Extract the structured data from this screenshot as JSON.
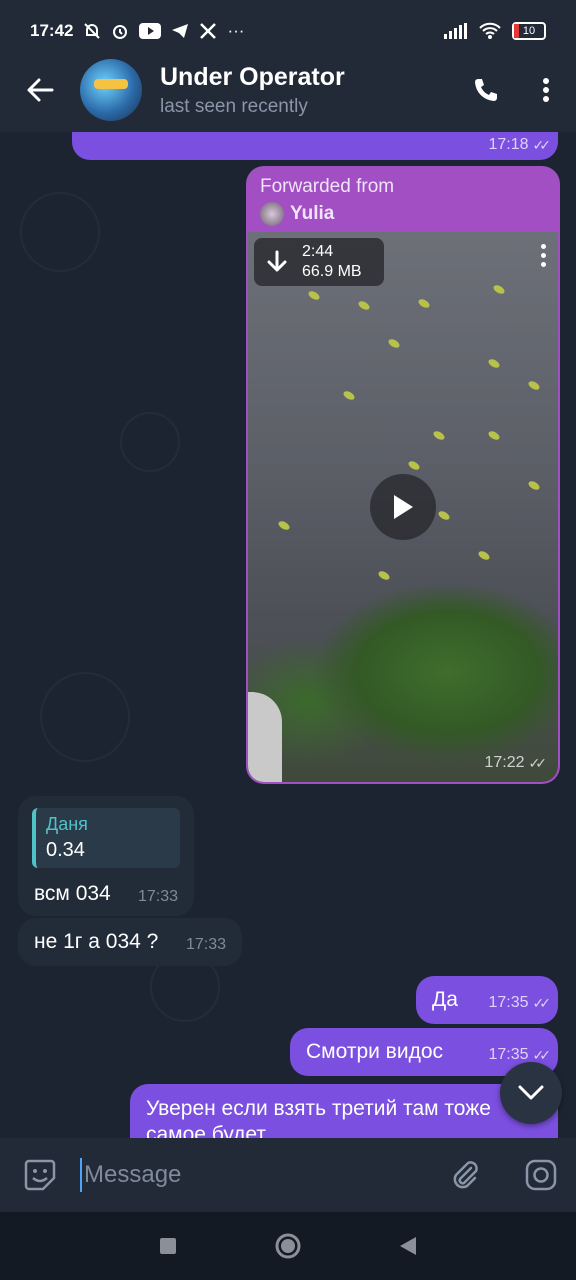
{
  "status_bar": {
    "time": "17:42",
    "battery": "10"
  },
  "header": {
    "name": "Under Operator",
    "status": "last seen recently"
  },
  "messages": {
    "prev_time": "17:18",
    "video": {
      "forwarded_label": "Forwarded from",
      "forwarded_name": "Yulia",
      "duration": "2:44",
      "size": "66.9 MB",
      "time": "17:22"
    },
    "reply": {
      "quote_author": "Даня",
      "quote_text": "0.34",
      "text": "всм 034",
      "time": "17:33"
    },
    "in2": {
      "text": "не 1г а 034 ?",
      "time": "17:33"
    },
    "out1": {
      "text": "Да",
      "time": "17:35"
    },
    "out2": {
      "text": "Смотри видос",
      "time": "17:35"
    },
    "out3": {
      "text": "Уверен если взять третий там тоже самое будет"
    }
  },
  "input": {
    "placeholder": "Message"
  },
  "colors": {
    "outgoing": "#7b4fe0",
    "forwarded": "#a24fc4",
    "incoming": "#222b38",
    "accent": "#4ea4f6"
  }
}
